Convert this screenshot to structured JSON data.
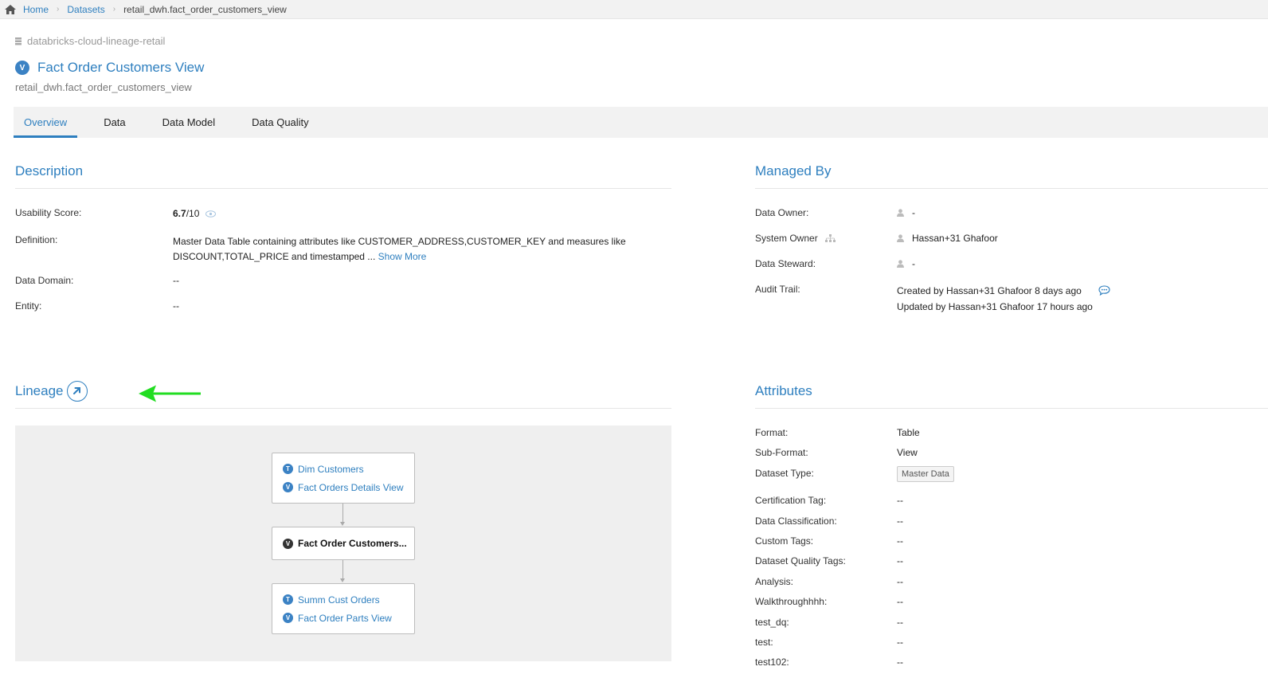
{
  "breadcrumb": {
    "home": "Home",
    "datasets": "Datasets",
    "current": "retail_dwh.fact_order_customers_view"
  },
  "header": {
    "source": "databricks-cloud-lineage-retail",
    "type_badge": "V",
    "title": "Fact Order Customers View",
    "subtitle": "retail_dwh.fact_order_customers_view"
  },
  "tabs": [
    {
      "label": "Overview",
      "active": true
    },
    {
      "label": "Data",
      "active": false
    },
    {
      "label": "Data Model",
      "active": false
    },
    {
      "label": "Data Quality",
      "active": false
    }
  ],
  "description": {
    "title": "Description",
    "usability_label": "Usability Score:",
    "usability_score": "6.7",
    "usability_max": "/10",
    "definition_label": "Definition:",
    "definition_line1": "Master Data Table containing attributes like CUSTOMER_ADDRESS,CUSTOMER_KEY and measures like",
    "definition_line2": "DISCOUNT,TOTAL_PRICE and timestamped ...",
    "show_more": "Show More",
    "domain_label": "Data Domain:",
    "domain_value": "--",
    "entity_label": "Entity:",
    "entity_value": "--"
  },
  "managed_by": {
    "title": "Managed By",
    "data_owner_label": "Data Owner:",
    "data_owner_value": "-",
    "system_owner_label": "System Owner",
    "system_owner_value": "Hassan+31 Ghafoor",
    "data_steward_label": "Data Steward:",
    "data_steward_value": "-",
    "audit_label": "Audit Trail:",
    "audit_created": "Created by Hassan+31 Ghafoor 8 days ago",
    "audit_updated": "Updated by Hassan+31 Ghafoor 17 hours ago"
  },
  "lineage": {
    "title": "Lineage",
    "upstream": [
      {
        "badge": "T",
        "label": "Dim Customers"
      },
      {
        "badge": "V",
        "label": "Fact Orders Details View"
      }
    ],
    "current": {
      "badge": "V",
      "label": "Fact Order Customers..."
    },
    "downstream": [
      {
        "badge": "T",
        "label": "Summ Cust Orders"
      },
      {
        "badge": "V",
        "label": "Fact Order Parts View"
      }
    ]
  },
  "attributes": {
    "title": "Attributes",
    "rows": [
      {
        "label": "Format:",
        "value": "Table"
      },
      {
        "label": "Sub-Format:",
        "value": "View"
      },
      {
        "label": "Dataset Type:",
        "value": "Master Data"
      },
      {
        "label": "Certification Tag:",
        "value": "--"
      },
      {
        "label": "Data Classification:",
        "value": "--"
      },
      {
        "label": "Custom Tags:",
        "value": "--"
      },
      {
        "label": "Dataset Quality Tags:",
        "value": "--"
      },
      {
        "label": "Analysis:",
        "value": "--"
      },
      {
        "label": "Walkthroughhhh:",
        "value": "--"
      },
      {
        "label": "test_dq:",
        "value": "--"
      },
      {
        "label": "test:",
        "value": "--"
      },
      {
        "label": "test102:",
        "value": "--"
      }
    ]
  },
  "colors": {
    "accent": "#2e7fbf",
    "arrow": "#22dd22"
  }
}
